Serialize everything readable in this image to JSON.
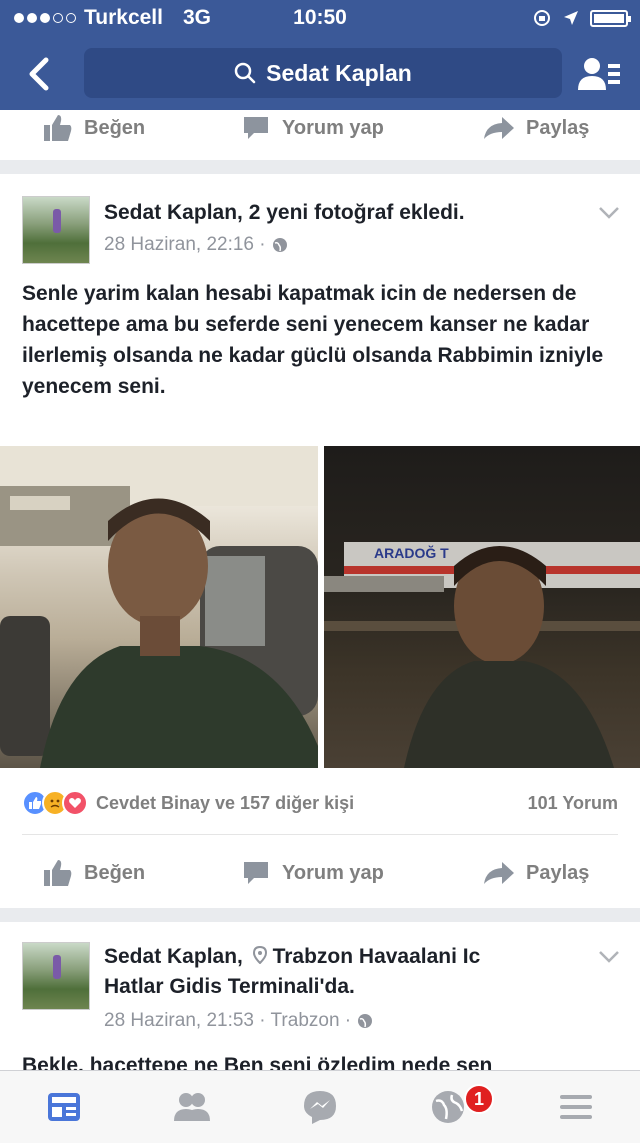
{
  "status_bar": {
    "carrier": "Turkcell",
    "network": "3G",
    "time": "10:50"
  },
  "nav": {
    "search_text": "Sedat Kaplan"
  },
  "actions": {
    "like": "Beğen",
    "comment": "Yorum yap",
    "share": "Paylaş"
  },
  "post1": {
    "author": "Sedat Kaplan, 2 yeni fotoğraf ekledi.",
    "date": "28 Haziran, 22:16 ·",
    "text": "Senle yarim kalan hesabi kapatmak icin de nedersen de hacettepe ama bu seferde seni yenecem kanser ne kadar ilerlemiş olsanda ne kadar güclü olsanda Rabbimin izniyle yenecem seni.",
    "reactions_text": "Cevdet Binay ve 157 diğer kişi",
    "comments": "101 Yorum",
    "plane_text": "ARADOĞ T"
  },
  "post2": {
    "author_line1": "Sedat Kaplan,",
    "place_line1": "Trabzon Havaalani Ic",
    "place_line2": "Hatlar Gidis Terminali'da.",
    "date": "28 Haziran, 21:53 · Trabzon ·",
    "text_preview": "Bekle, hacettepe ne Ben seni özledim nede sen"
  },
  "tabbar": {
    "notification_count": "1"
  },
  "colors": {
    "facebook_blue": "#3b5998",
    "like_blue": "#5890ff",
    "love_red": "#f25268",
    "sad_yellow": "#f7b125"
  }
}
